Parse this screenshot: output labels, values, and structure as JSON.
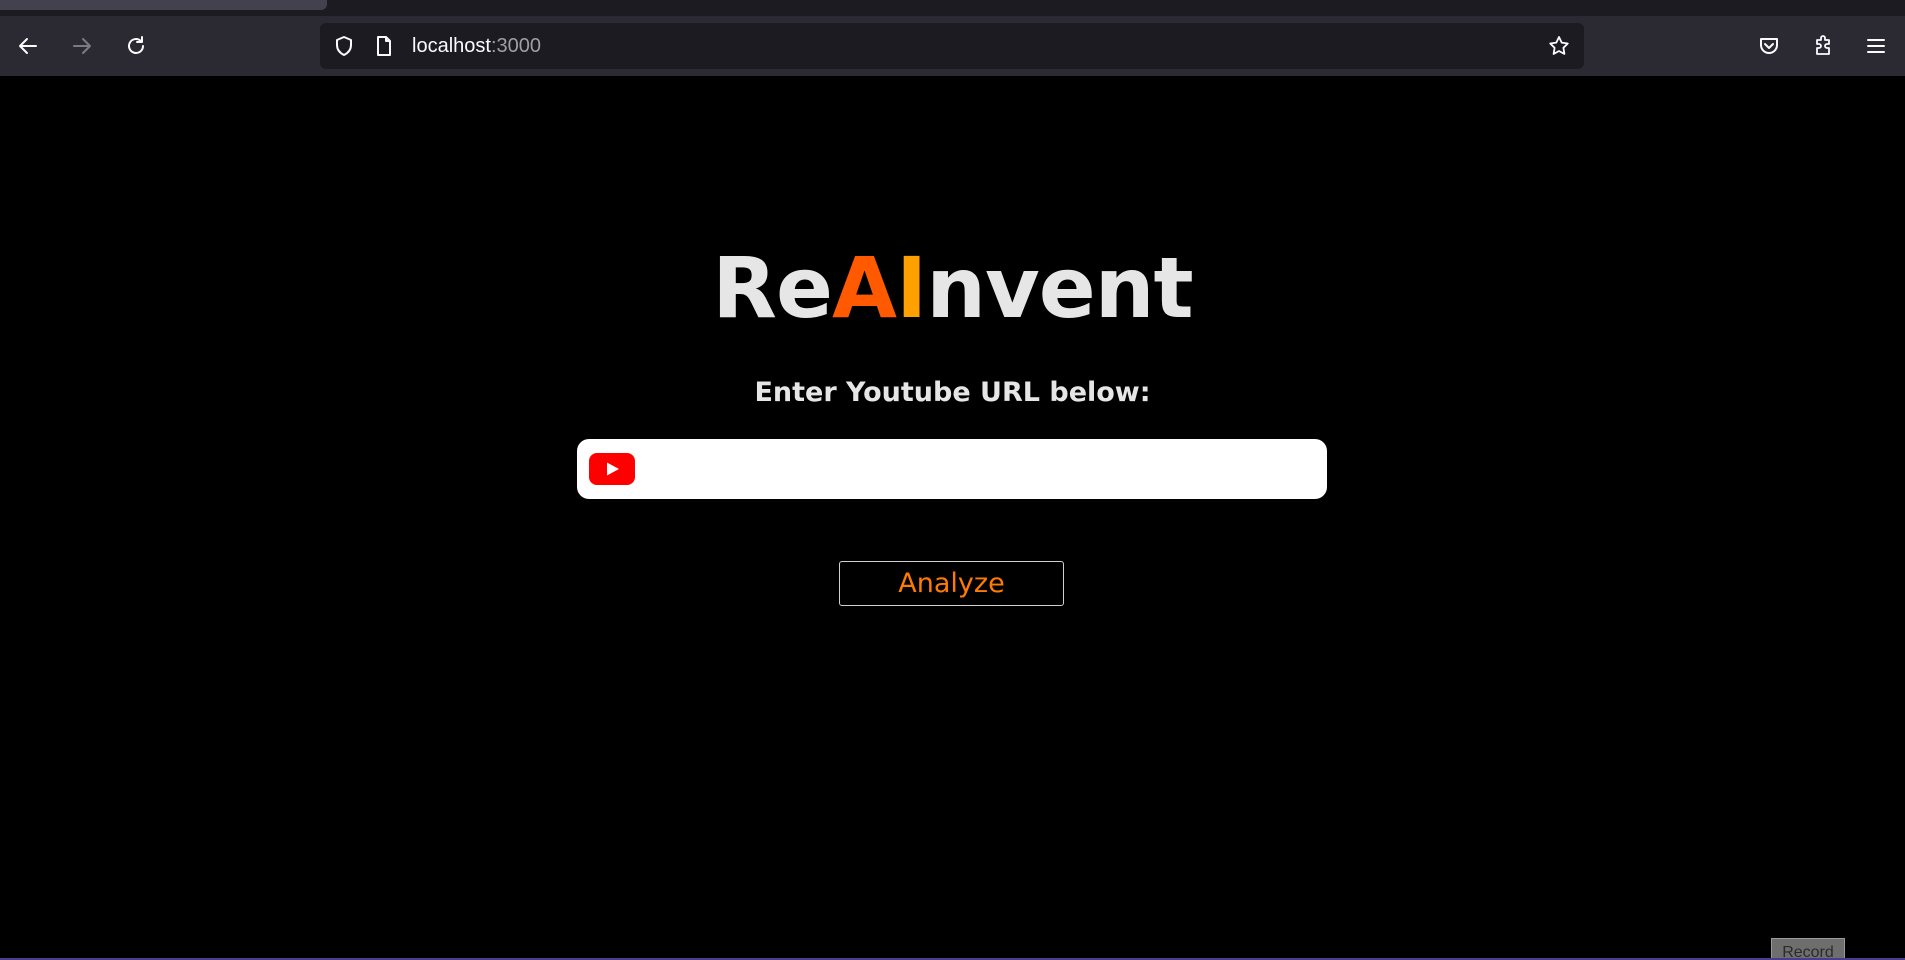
{
  "browser": {
    "url_host": "localhost",
    "url_port": ":3000"
  },
  "app": {
    "logo_prefix": "Re",
    "logo_a": "A",
    "logo_i": "I",
    "logo_suffix": "nvent",
    "subtitle": "Enter Youtube URL below:",
    "url_input_value": "",
    "url_input_placeholder": "",
    "analyze_label": "Analyze",
    "record_label": "Record"
  },
  "colors": {
    "accent_orange": "#ff5a00",
    "accent_amber": "#ffa000",
    "youtube_red": "#ff0000",
    "background": "#000000"
  },
  "icons": [
    "back-arrow-icon",
    "forward-arrow-icon",
    "reload-icon",
    "shield-icon",
    "page-icon",
    "star-icon",
    "pocket-icon",
    "extensions-icon",
    "menu-icon",
    "youtube-icon"
  ]
}
